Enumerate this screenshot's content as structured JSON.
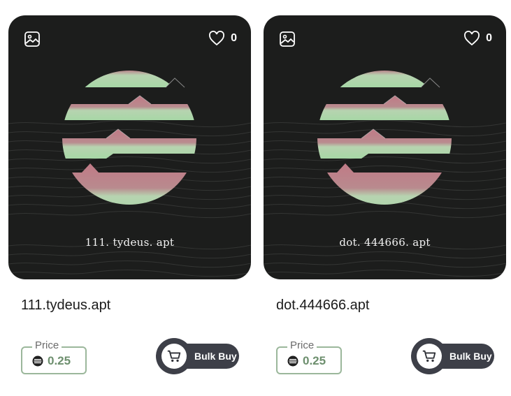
{
  "colors": {
    "card_bg": "#1c1d1c",
    "price_border": "#9bb79b",
    "price_text": "#6d8f6e",
    "button_bg": "#3d3f48",
    "art_pink": "#c07a86",
    "art_green": "#a7d7a6"
  },
  "cards": [
    {
      "domain_label": "111. tydeus. apt",
      "title": "111.tydeus.apt",
      "likes": "0",
      "price_label": "Price",
      "price": "0.25",
      "bulk_buy_label": "Bulk Buy",
      "icons": {
        "image": "image-icon",
        "like": "heart-icon",
        "currency": "aptos-icon",
        "cart": "cart-icon"
      }
    },
    {
      "domain_label": "dot. 444666. apt",
      "title": "dot.444666.apt",
      "likes": "0",
      "price_label": "Price",
      "price": "0.25",
      "bulk_buy_label": "Bulk Buy",
      "icons": {
        "image": "image-icon",
        "like": "heart-icon",
        "currency": "aptos-icon",
        "cart": "cart-icon"
      }
    }
  ]
}
